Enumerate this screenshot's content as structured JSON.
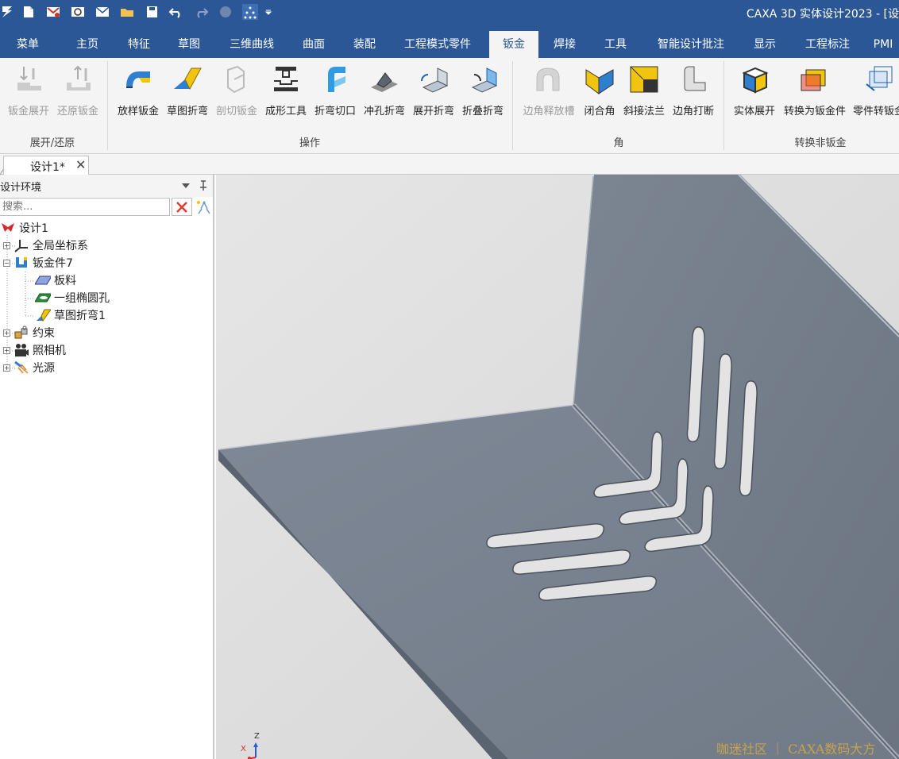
{
  "app": {
    "window_title": "CAXA 3D 实体设计2023 - [设"
  },
  "quick_access": [
    {
      "name": "app-menu-icon"
    },
    {
      "name": "new-file-icon"
    },
    {
      "name": "new-design-icon"
    },
    {
      "name": "open-design-icon"
    },
    {
      "name": "mail-icon"
    },
    {
      "name": "open-folder-icon"
    },
    {
      "name": "save-icon"
    },
    {
      "name": "undo-icon"
    },
    {
      "name": "redo-icon"
    },
    {
      "name": "render-sphere-icon"
    },
    {
      "name": "design-tree-icon"
    },
    {
      "name": "customize-dropdown-icon"
    }
  ],
  "ribbon_tabs": [
    {
      "label": "菜单",
      "active": false
    },
    {
      "label": "主页",
      "active": false
    },
    {
      "label": "特征",
      "active": false
    },
    {
      "label": "草图",
      "active": false
    },
    {
      "label": "三维曲线",
      "active": false
    },
    {
      "label": "曲面",
      "active": false
    },
    {
      "label": "装配",
      "active": false
    },
    {
      "label": "工程模式零件",
      "active": false
    },
    {
      "label": "钣金",
      "active": true
    },
    {
      "label": "焊接",
      "active": false
    },
    {
      "label": "工具",
      "active": false
    },
    {
      "label": "智能设计批注",
      "active": false
    },
    {
      "label": "显示",
      "active": false
    },
    {
      "label": "工程标注",
      "active": false
    },
    {
      "label": "PMI",
      "active": false
    }
  ],
  "ribbon": {
    "groups": [
      {
        "label": "展开/还原"
      },
      {
        "label": "操作"
      },
      {
        "label": "角"
      },
      {
        "label": "转换非钣金"
      }
    ],
    "buttons": [
      {
        "label": "钣金展开",
        "enabled": false,
        "icon": "sheet-unfold-icon"
      },
      {
        "label": "还原钣金",
        "enabled": false,
        "icon": "sheet-restore-icon"
      },
      {
        "label": "放样钣金",
        "enabled": true,
        "icon": "loft-sheet-icon"
      },
      {
        "label": "草图折弯",
        "enabled": true,
        "icon": "sketch-bend-icon"
      },
      {
        "label": "剖切钣金",
        "enabled": false,
        "icon": "cut-sheet-icon"
      },
      {
        "label": "成形工具",
        "enabled": true,
        "icon": "forming-tool-icon"
      },
      {
        "label": "折弯切口",
        "enabled": true,
        "icon": "bend-notch-icon"
      },
      {
        "label": "冲孔折弯",
        "enabled": true,
        "icon": "punch-bend-icon"
      },
      {
        "label": "展开折弯",
        "enabled": true,
        "icon": "unfold-bend-icon"
      },
      {
        "label": "折叠折弯",
        "enabled": true,
        "icon": "fold-bend-icon"
      },
      {
        "label": "边角释放槽",
        "enabled": false,
        "icon": "corner-relief-icon"
      },
      {
        "label": "闭合角",
        "enabled": true,
        "icon": "close-corner-icon"
      },
      {
        "label": "斜接法兰",
        "enabled": true,
        "icon": "miter-flange-icon"
      },
      {
        "label": "边角打断",
        "enabled": true,
        "icon": "corner-break-icon"
      },
      {
        "label": "实体展开",
        "enabled": true,
        "icon": "solid-unfold-icon"
      },
      {
        "label": "转换为钣金件",
        "enabled": true,
        "icon": "convert-to-sheet-icon"
      },
      {
        "label": "零件转钣金",
        "enabled": true,
        "icon": "part-to-sheet-icon"
      }
    ]
  },
  "doc_tab": {
    "label": "设计1*",
    "close": "✕"
  },
  "design_pane": {
    "title": "设计环境",
    "search_placeholder": "搜索...",
    "tree": [
      {
        "label": "设计1",
        "level": 0,
        "expander": "",
        "icon": "design-root-icon"
      },
      {
        "label": "全局坐标系",
        "level": 1,
        "expander": "+",
        "icon": "coordinate-system-icon"
      },
      {
        "label": "钣金件7",
        "level": 1,
        "expander": "−",
        "icon": "sheet-metal-part-icon"
      },
      {
        "label": "板料",
        "level": 2,
        "expander": "",
        "icon": "sheet-stock-icon"
      },
      {
        "label": "一组椭圆孔",
        "level": 2,
        "expander": "",
        "icon": "oval-holes-icon"
      },
      {
        "label": "草图折弯1",
        "level": 2,
        "expander": "",
        "icon": "sketch-bend-feature-icon"
      },
      {
        "label": "约束",
        "level": 1,
        "expander": "+",
        "icon": "constraint-icon"
      },
      {
        "label": "照相机",
        "level": 1,
        "expander": "+",
        "icon": "camera-icon"
      },
      {
        "label": "光源",
        "level": 1,
        "expander": "+",
        "icon": "light-icon"
      }
    ]
  },
  "viewport": {
    "watermark": "咖迷社区 ｜ CAXA数码大方",
    "triad_z": "Z",
    "triad_x": "X"
  },
  "colors": {
    "title_blue": "#2b5797",
    "ribbon_bg": "#f4f4f4",
    "sheet_grey": "#788290",
    "viewport_bg": "#dcdcdc"
  }
}
